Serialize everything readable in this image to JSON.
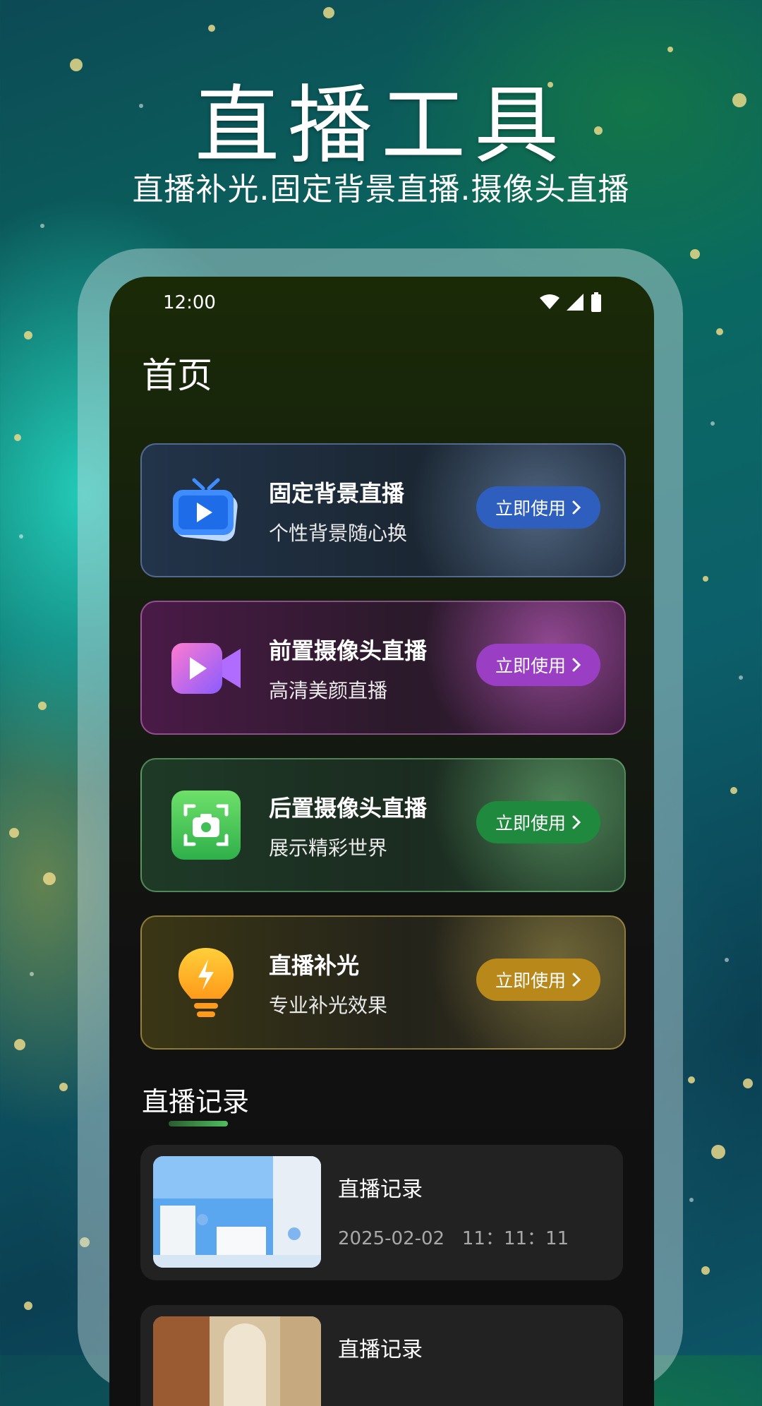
{
  "promo": {
    "title": "直播工具",
    "subtitle": "直播补光.固定背景直播.摄像头直播"
  },
  "status_bar": {
    "time": "12:00",
    "icons": [
      "wifi-icon",
      "signal-icon",
      "battery-icon"
    ]
  },
  "page": {
    "title": "首页"
  },
  "features": [
    {
      "title": "固定背景直播",
      "subtitle": "个性背景随心换",
      "button": "立即使用",
      "icon": "tv-play-icon",
      "accent": "#2e5fbf"
    },
    {
      "title": "前置摄像头直播",
      "subtitle": "高清美颜直播",
      "button": "立即使用",
      "icon": "video-camera-icon",
      "accent": "#9a3fc4"
    },
    {
      "title": "后置摄像头直播",
      "subtitle": "展示精彩世界",
      "button": "立即使用",
      "icon": "camera-scan-icon",
      "accent": "#1f8a3e"
    },
    {
      "title": "直播补光",
      "subtitle": "专业补光效果",
      "button": "立即使用",
      "icon": "lightbulb-icon",
      "accent": "#b8891a"
    }
  ],
  "records_section": {
    "title": "直播记录",
    "items": [
      {
        "title": "直播记录",
        "time": "2025-02-02   11：11：11"
      },
      {
        "title": "直播记录",
        "time": ""
      }
    ]
  }
}
